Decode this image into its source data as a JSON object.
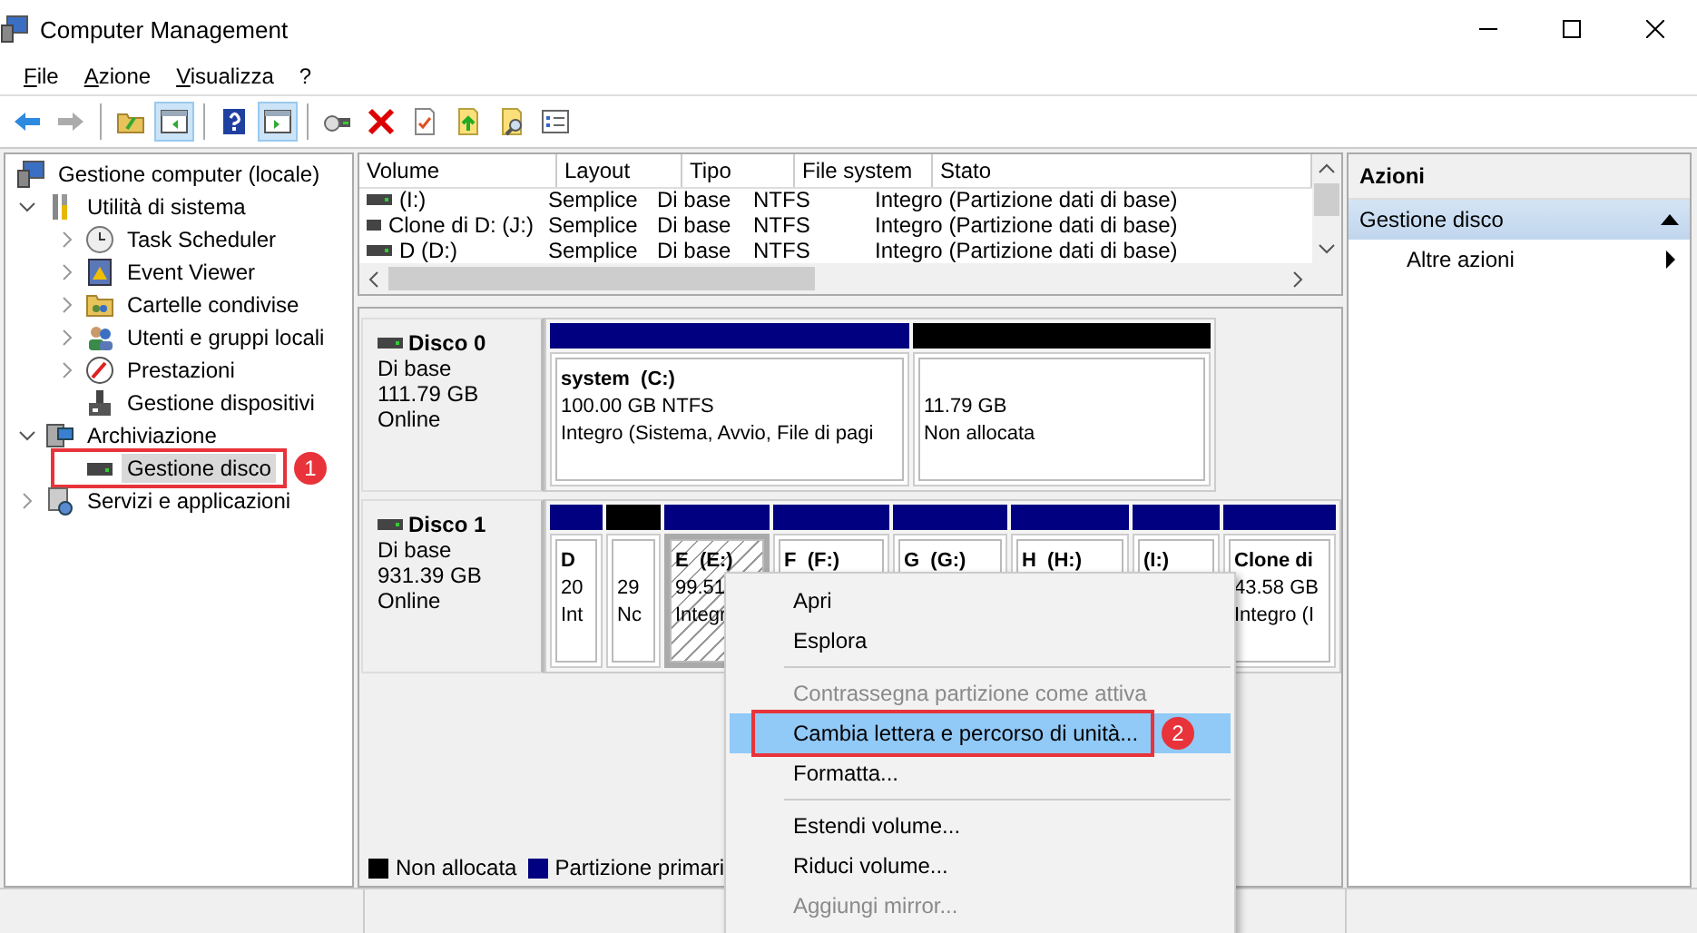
{
  "window": {
    "title": "Computer Management"
  },
  "menu_bar": [
    "File",
    "Azione",
    "Visualizza",
    "?"
  ],
  "toolbar": [
    {
      "kind": "back",
      "disabled": false,
      "pressed": false
    },
    {
      "kind": "forward",
      "disabled": true,
      "pressed": false
    },
    {
      "kind": "separator"
    },
    {
      "kind": "up-folder",
      "disabled": false,
      "pressed": false
    },
    {
      "kind": "console-tree",
      "disabled": false,
      "pressed": true
    },
    {
      "kind": "separator"
    },
    {
      "kind": "help",
      "disabled": false,
      "pressed": false
    },
    {
      "kind": "action-pane",
      "disabled": false,
      "pressed": true
    },
    {
      "kind": "separator"
    },
    {
      "kind": "connect",
      "disabled": false,
      "pressed": false
    },
    {
      "kind": "delete",
      "disabled": false,
      "pressed": false
    },
    {
      "kind": "properties",
      "disabled": false,
      "pressed": false
    },
    {
      "kind": "export",
      "disabled": false,
      "pressed": false
    },
    {
      "kind": "find",
      "disabled": false,
      "pressed": false
    },
    {
      "kind": "list",
      "disabled": false,
      "pressed": false
    }
  ],
  "tree": [
    {
      "label": "Gestione computer (locale)",
      "selected": false,
      "children": [
        {
          "label": "Utilità di sistema",
          "expanded": true,
          "selected": false,
          "children": [
            {
              "label": "Task Scheduler",
              "expanded": false,
              "selected": false
            },
            {
              "label": "Event Viewer",
              "expanded": false,
              "selected": false
            },
            {
              "label": "Cartelle condivise",
              "expanded": false,
              "selected": false
            },
            {
              "label": "Utenti e gruppi locali",
              "expanded": false,
              "selected": false
            },
            {
              "label": "Prestazioni",
              "expanded": false,
              "selected": false
            },
            {
              "label": "Gestione dispositivi",
              "selected": false
            }
          ]
        },
        {
          "label": "Archiviazione",
          "expanded": true,
          "selected": false,
          "children": [
            {
              "label": "Gestione disco",
              "selected": true,
              "callout": "1"
            }
          ]
        },
        {
          "label": "Servizi e applicazioni",
          "expanded": false,
          "selected": false
        }
      ]
    }
  ],
  "volume_table": {
    "columns": [
      "Volume",
      "Layout",
      "Tipo",
      "File system",
      "Stato"
    ],
    "rows": [
      [
        "(I:)",
        "Semplice",
        "Di base",
        "NTFS",
        "Integro (Partizione dati di base)"
      ],
      [
        "Clone di D: (J:)",
        "Semplice",
        "Di base",
        "NTFS",
        "Integro (Partizione dati di base)"
      ],
      [
        "D (D:)",
        "Semplice",
        "Di base",
        "NTFS",
        "Integro (Partizione dati di base)"
      ]
    ]
  },
  "disks": [
    {
      "name": "Disco 0",
      "type": "Di base",
      "size": "111.79 GB",
      "status": "Online",
      "partitions": [
        {
          "kind": "primary",
          "selected": false,
          "title": "system  (C:)",
          "lines": [
            "100.00 GB NTFS",
            "Integro (Sistema, Avvio, File di pagi"
          ]
        },
        {
          "kind": "unallocated",
          "selected": false,
          "lines": [
            "11.79 GB",
            "Non allocata"
          ]
        }
      ]
    },
    {
      "name": "Disco 1",
      "type": "Di base",
      "size": "931.39 GB",
      "status": "Online",
      "partitions": [
        {
          "kind": "primary",
          "selected": false,
          "title": "D",
          "lines": [
            "20",
            "Int"
          ]
        },
        {
          "kind": "unallocated",
          "selected": false,
          "lines": [
            "29",
            "Nc"
          ]
        },
        {
          "kind": "primary",
          "selected": true,
          "title": "E  (E:)",
          "lines": [
            "99.51",
            "Integr"
          ]
        },
        {
          "kind": "primary",
          "selected": false,
          "title": "F  (F:)"
        },
        {
          "kind": "primary",
          "selected": false,
          "title": "G  (G:)"
        },
        {
          "kind": "primary",
          "selected": false,
          "title": "H  (H:)"
        },
        {
          "kind": "primary",
          "selected": false,
          "title": "(I:)"
        },
        {
          "kind": "primary",
          "selected": false,
          "title": "Clone di",
          "lines": [
            "43.58 GB",
            "Integro (I"
          ]
        }
      ]
    }
  ],
  "legend": [
    {
      "label": "Non allocata",
      "color": "#000000"
    },
    {
      "label": "Partizione primari",
      "color": "#000080"
    }
  ],
  "actions": {
    "title": "Azioni",
    "sections": [
      {
        "label": "Gestione disco",
        "selected": true,
        "items": [
          "Altre azioni"
        ]
      }
    ]
  },
  "context_menu": [
    {
      "kind": "item",
      "label": "Apri",
      "disabled": false,
      "selected": false
    },
    {
      "kind": "item",
      "label": "Esplora",
      "disabled": false,
      "selected": false
    },
    {
      "kind": "separator"
    },
    {
      "kind": "item",
      "label": "Contrassegna partizione come attiva",
      "disabled": true,
      "selected": false
    },
    {
      "kind": "item",
      "label": "Cambia lettera e percorso di unità...",
      "disabled": false,
      "selected": true,
      "callout": "2"
    },
    {
      "kind": "item",
      "label": "Formatta...",
      "disabled": false,
      "selected": false
    },
    {
      "kind": "separator"
    },
    {
      "kind": "item",
      "label": "Estendi volume...",
      "disabled": false,
      "selected": false
    },
    {
      "kind": "item",
      "label": "Riduci volume...",
      "disabled": false,
      "selected": false
    },
    {
      "kind": "item",
      "label": "Aggiungi mirror...",
      "disabled": true,
      "selected": false
    }
  ]
}
